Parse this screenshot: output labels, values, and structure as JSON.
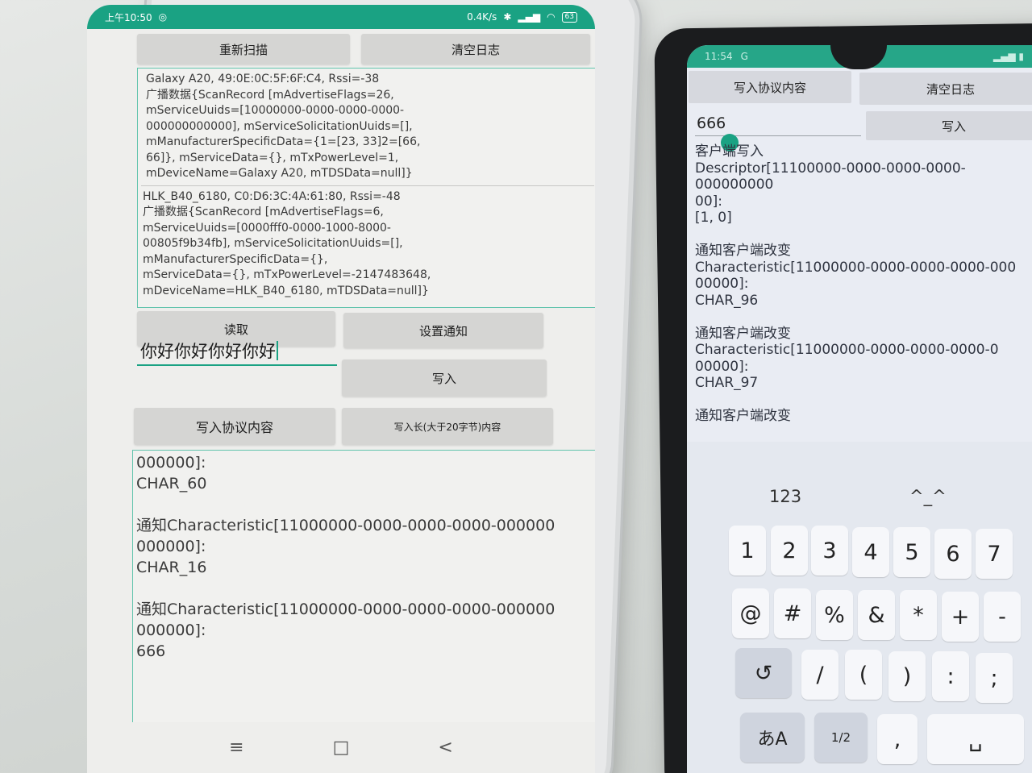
{
  "left_phone": {
    "status_bar": {
      "time": "上午10:50",
      "speed": "0.4K/s",
      "battery": "63"
    },
    "top_buttons": {
      "rescan": "重新扫描",
      "clear_log": "清空日志"
    },
    "scan_results": [
      "Galaxy A20, 49:0E:0C:5F:6F:C4, Rssi=-38\n广播数据{ScanRecord [mAdvertiseFlags=26,\nmServiceUuids=[10000000-0000-0000-0000-\n000000000000], mServiceSolicitationUuids=[],\nmManufacturerSpecificData={1=[23, 33]2=[66,\n66]}, mServiceData={}, mTxPowerLevel=1,\nmDeviceName=Galaxy A20, mTDSData=null]}",
      "HLK_B40_6180, C0:D6:3C:4A:61:80, Rssi=-48\n广播数据{ScanRecord [mAdvertiseFlags=6,\nmServiceUuids=[0000fff0-0000-1000-8000-\n00805f9b34fb], mServiceSolicitationUuids=[],\nmManufacturerSpecificData={},\nmServiceData={}, mTxPowerLevel=-2147483648,\nmDeviceName=HLK_B40_6180, mTDSData=null]}"
    ],
    "action_buttons": {
      "read": "读取",
      "set_notify": "设置通知",
      "write": "写入",
      "write_protocol": "写入协议内容",
      "write_long": "写入长(大于20字节)内容"
    },
    "input_value": "你好你好你好你好",
    "log": "000000]:\nCHAR_60\n\n通知Characteristic[11000000-0000-0000-0000-000000\n000000]:\nCHAR_16\n\n通知Characteristic[11000000-0000-0000-0000-000000\n000000]:\n666",
    "nav": {
      "menu": "≡",
      "home": "□",
      "back": "<"
    }
  },
  "right_phone": {
    "status_bar": {
      "time": "11:54",
      "icons": "G"
    },
    "top_buttons": {
      "write_protocol": "写入协议内容",
      "clear_log": "清空日志"
    },
    "input_value": "666",
    "write_button": "写入",
    "log": "客户端写入\nDescriptor[11100000-0000-0000-0000-000000000\n00]:\n[1, 0]\n\n通知客户端改变\nCharacteristic[11000000-0000-0000-0000-000\n00000]:\nCHAR_96\n\n通知客户端改变\nCharacteristic[11000000-0000-0000-0000-0\n00000]:\nCHAR_97\n\n通知客户端改变",
    "keyboard": {
      "mode_label": "123",
      "emoticon": "^_^",
      "row1": [
        "1",
        "2",
        "3",
        "4",
        "5",
        "6",
        "7"
      ],
      "row2": [
        "@",
        "#",
        "%",
        "&",
        "*",
        "+",
        "-"
      ],
      "row3": [
        "↺",
        "/",
        "(",
        ")",
        ":",
        ";"
      ],
      "row4": [
        "あA",
        "1/2",
        ",",
        "␣"
      ]
    }
  }
}
